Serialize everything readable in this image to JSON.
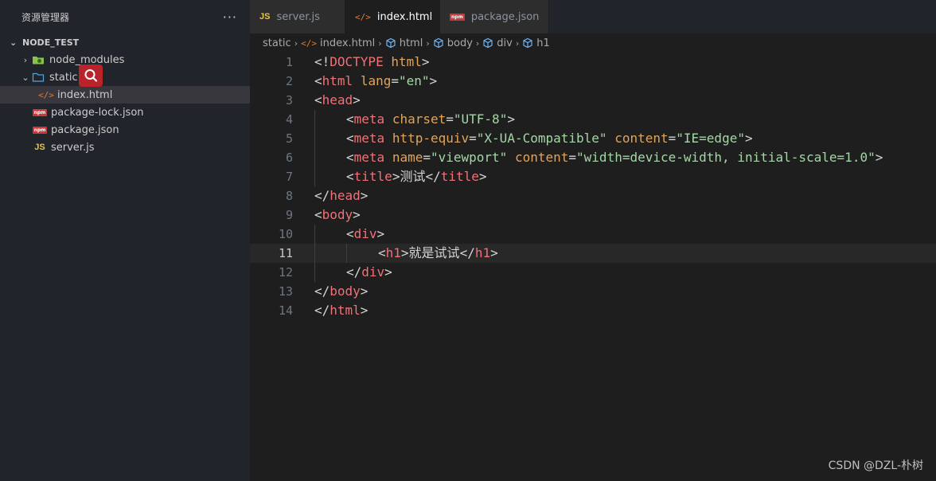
{
  "sidebar": {
    "title": "资源管理器",
    "more": "···",
    "section": "NODE_TEST",
    "items": [
      {
        "label": "node_modules",
        "chevron": "›",
        "icon": "node-modules-folder-icon"
      },
      {
        "label": "static",
        "chevron": "⌄",
        "icon": "folder-icon"
      },
      {
        "label": "index.html",
        "icon": "html-file-icon",
        "badge": "</>"
      },
      {
        "label": "package-lock.json",
        "icon": "npm-icon",
        "badge": "npm"
      },
      {
        "label": "package.json",
        "icon": "npm-icon",
        "badge": "npm"
      },
      {
        "label": "server.js",
        "icon": "js-icon",
        "badge": "JS"
      }
    ]
  },
  "tabs": [
    {
      "label": "server.js",
      "badge": "JS",
      "icon": "js-icon"
    },
    {
      "label": "index.html",
      "badge": "</>",
      "icon": "html-file-icon",
      "close": "×"
    },
    {
      "label": "package.json",
      "badge": "npm",
      "icon": "npm-icon"
    }
  ],
  "breadcrumb": [
    {
      "label": "static"
    },
    {
      "label": "index.html",
      "badge": "</>"
    },
    {
      "label": "html"
    },
    {
      "label": "body"
    },
    {
      "label": "div"
    },
    {
      "label": "h1"
    }
  ],
  "editor": {
    "current_line": 11,
    "lines": [
      {
        "n": "1",
        "tokens": [
          [
            "p",
            "<!"
          ],
          [
            "t",
            "DOCTYPE"
          ],
          [
            "p",
            " "
          ],
          [
            "a",
            "html"
          ],
          [
            "p",
            ">"
          ]
        ]
      },
      {
        "n": "2",
        "tokens": [
          [
            "p",
            "<"
          ],
          [
            "t",
            "html"
          ],
          [
            "p",
            " "
          ],
          [
            "a",
            "lang"
          ],
          [
            "p",
            "="
          ],
          [
            "s",
            "\"en\""
          ],
          [
            "p",
            ">"
          ]
        ]
      },
      {
        "n": "3",
        "tokens": [
          [
            "p",
            "<"
          ],
          [
            "t",
            "head"
          ],
          [
            "p",
            ">"
          ]
        ]
      },
      {
        "n": "4",
        "indent": 1,
        "tokens": [
          [
            "p",
            "<"
          ],
          [
            "t",
            "meta"
          ],
          [
            "p",
            " "
          ],
          [
            "a",
            "charset"
          ],
          [
            "p",
            "="
          ],
          [
            "s",
            "\"UTF-8\""
          ],
          [
            "p",
            ">"
          ]
        ]
      },
      {
        "n": "5",
        "indent": 1,
        "tokens": [
          [
            "p",
            "<"
          ],
          [
            "t",
            "meta"
          ],
          [
            "p",
            " "
          ],
          [
            "a",
            "http-equiv"
          ],
          [
            "p",
            "="
          ],
          [
            "s",
            "\"X-UA-Compatible\""
          ],
          [
            "p",
            " "
          ],
          [
            "a",
            "content"
          ],
          [
            "p",
            "="
          ],
          [
            "s",
            "\"IE=edge\""
          ],
          [
            "p",
            ">"
          ]
        ]
      },
      {
        "n": "6",
        "indent": 1,
        "tokens": [
          [
            "p",
            "<"
          ],
          [
            "t",
            "meta"
          ],
          [
            "p",
            " "
          ],
          [
            "a",
            "name"
          ],
          [
            "p",
            "="
          ],
          [
            "s",
            "\"viewport\""
          ],
          [
            "p",
            " "
          ],
          [
            "a",
            "content"
          ],
          [
            "p",
            "="
          ],
          [
            "s",
            "\"width=device-width, initial-scale=1.0\""
          ],
          [
            "p",
            ">"
          ]
        ]
      },
      {
        "n": "7",
        "indent": 1,
        "tokens": [
          [
            "p",
            "<"
          ],
          [
            "t",
            "title"
          ],
          [
            "p",
            ">"
          ],
          [
            "x",
            "测试"
          ],
          [
            "p",
            "</"
          ],
          [
            "t",
            "title"
          ],
          [
            "p",
            ">"
          ]
        ]
      },
      {
        "n": "8",
        "tokens": [
          [
            "p",
            "</"
          ],
          [
            "t",
            "head"
          ],
          [
            "p",
            ">"
          ]
        ]
      },
      {
        "n": "9",
        "tokens": [
          [
            "p",
            "<"
          ],
          [
            "t",
            "body"
          ],
          [
            "p",
            ">"
          ]
        ]
      },
      {
        "n": "10",
        "indent": 1,
        "tokens": [
          [
            "p",
            "<"
          ],
          [
            "t",
            "div"
          ],
          [
            "p",
            ">"
          ]
        ]
      },
      {
        "n": "11",
        "indent": 2,
        "tokens": [
          [
            "p",
            "<"
          ],
          [
            "t",
            "h1"
          ],
          [
            "p",
            ">"
          ],
          [
            "x",
            "就是试试"
          ],
          [
            "p",
            "</"
          ],
          [
            "t",
            "h1"
          ],
          [
            "p",
            ">"
          ]
        ]
      },
      {
        "n": "12",
        "indent": 1,
        "tokens": [
          [
            "p",
            "</"
          ],
          [
            "t",
            "div"
          ],
          [
            "p",
            ">"
          ]
        ]
      },
      {
        "n": "13",
        "tokens": [
          [
            "p",
            "</"
          ],
          [
            "t",
            "body"
          ],
          [
            "p",
            ">"
          ]
        ]
      },
      {
        "n": "14",
        "tokens": [
          [
            "p",
            "</"
          ],
          [
            "t",
            "html"
          ],
          [
            "p",
            ">"
          ]
        ]
      }
    ]
  },
  "watermark": "CSDN @DZL-朴树",
  "colors": {
    "tag": "#f07178",
    "attr": "#e0a45d",
    "string": "#a5d6a7",
    "punct": "#d4d4d4"
  }
}
